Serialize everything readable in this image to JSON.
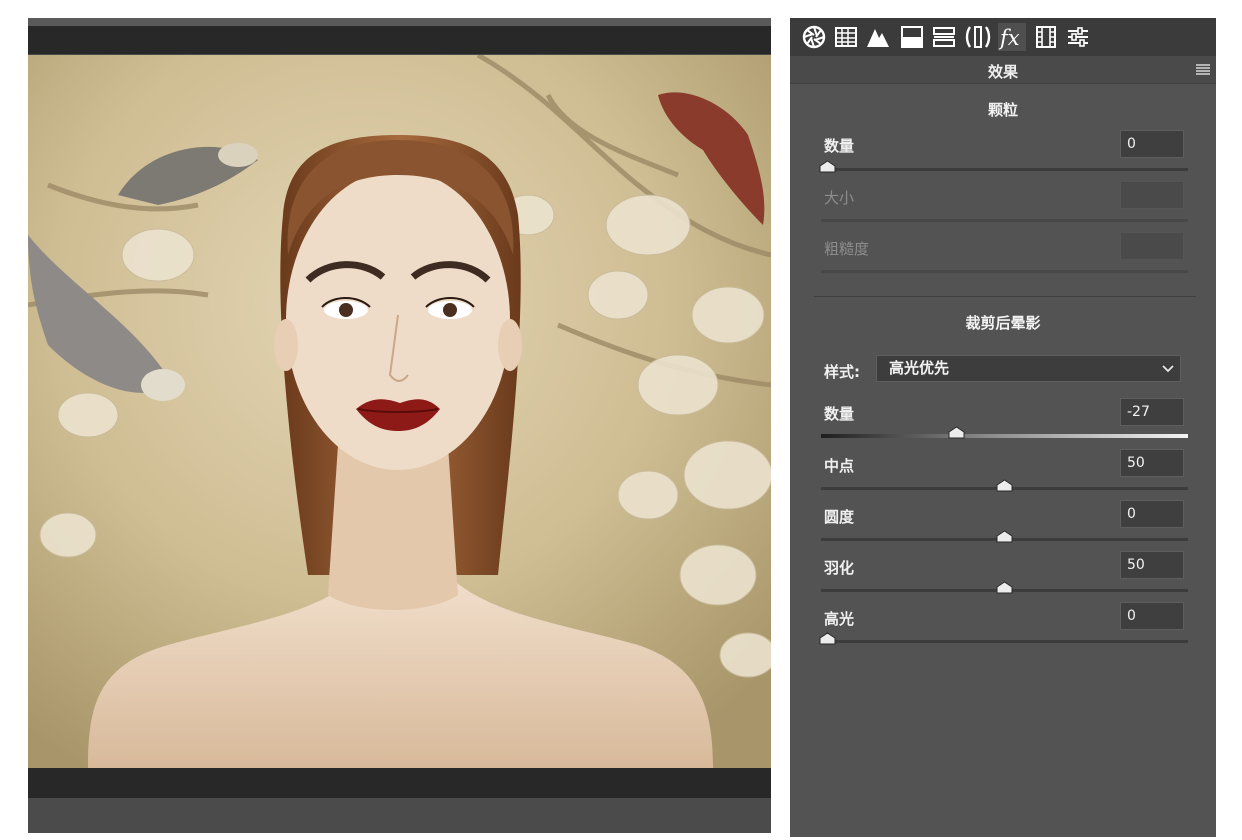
{
  "panel": {
    "title": "效果",
    "tabs": [
      {
        "icon": "aperture-icon"
      },
      {
        "icon": "grid-icon"
      },
      {
        "icon": "mountains-icon"
      },
      {
        "icon": "split-toning-icon"
      },
      {
        "icon": "hsl-bars-icon"
      },
      {
        "icon": "lens-icon"
      },
      {
        "icon": "fx-icon",
        "label": "fx",
        "active": true
      },
      {
        "icon": "film-calibration-icon"
      },
      {
        "icon": "sliders-icon"
      }
    ]
  },
  "grain": {
    "title": "颗粒",
    "amount": {
      "label": "数量",
      "value": "0",
      "position": 0.0
    },
    "size": {
      "label": "大小",
      "value": ""
    },
    "roughness": {
      "label": "粗糙度",
      "value": ""
    }
  },
  "vignette": {
    "title": "裁剪后晕影",
    "style_label": "样式:",
    "style_value": "高光优先",
    "amount": {
      "label": "数量",
      "value": "-27",
      "position": 0.365
    },
    "midpoint": {
      "label": "中点",
      "value": "50",
      "position": 0.5
    },
    "roundness": {
      "label": "圆度",
      "value": "0",
      "position": 0.5
    },
    "feather": {
      "label": "羽化",
      "value": "50",
      "position": 0.5
    },
    "highlights": {
      "label": "高光",
      "value": "0",
      "position": 0.0
    }
  },
  "colors": {
    "panel_bg": "#535353",
    "tab_bar": "#3b3b3b",
    "lip_red": "#8e1a17",
    "backdrop": "#c9b48a"
  }
}
